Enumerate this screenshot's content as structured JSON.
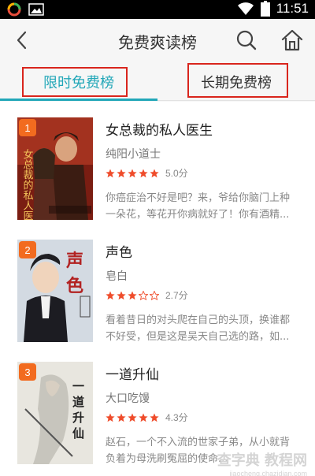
{
  "status_bar": {
    "time": "11:51",
    "icons": [
      "app-icon",
      "image-icon",
      "wifi-icon",
      "battery-icon"
    ]
  },
  "header": {
    "title": "免费爽读榜"
  },
  "tabs": [
    {
      "label": "限时免费榜",
      "active": true
    },
    {
      "label": "长期免费榜",
      "active": false
    }
  ],
  "books": [
    {
      "rank": "1",
      "title": "女总裁的私人医生",
      "author": "纯阳小道士",
      "stars": 5,
      "rating": "5.0分",
      "description": "你癌症治不好是吧？来，爷给你脑门上种一朵花，等花开你病就好了！你有酒精..."
    },
    {
      "rank": "2",
      "title": "声色",
      "author": "皂白",
      "stars": 3,
      "rating": "2.7分",
      "description": "看着昔日的对头爬在自己的头顶，换谁都不好受，但是这是吴天自己选的路，如..."
    },
    {
      "rank": "3",
      "title": "一道升仙",
      "author": "大口吃馒",
      "stars": 5,
      "rating": "4.3分",
      "description": "赵石，一个不入流的世家子弟，从小就背负着为母洗刷冤屈的使命..."
    }
  ],
  "watermark": {
    "main": "查字典 教程网",
    "sub": "jiaocheng.chazidian.com"
  },
  "colors": {
    "accent": "#22a7b8",
    "rank_badge": "#f26b1f",
    "star": "#ef4c2b",
    "highlight_box": "#d9251d"
  }
}
